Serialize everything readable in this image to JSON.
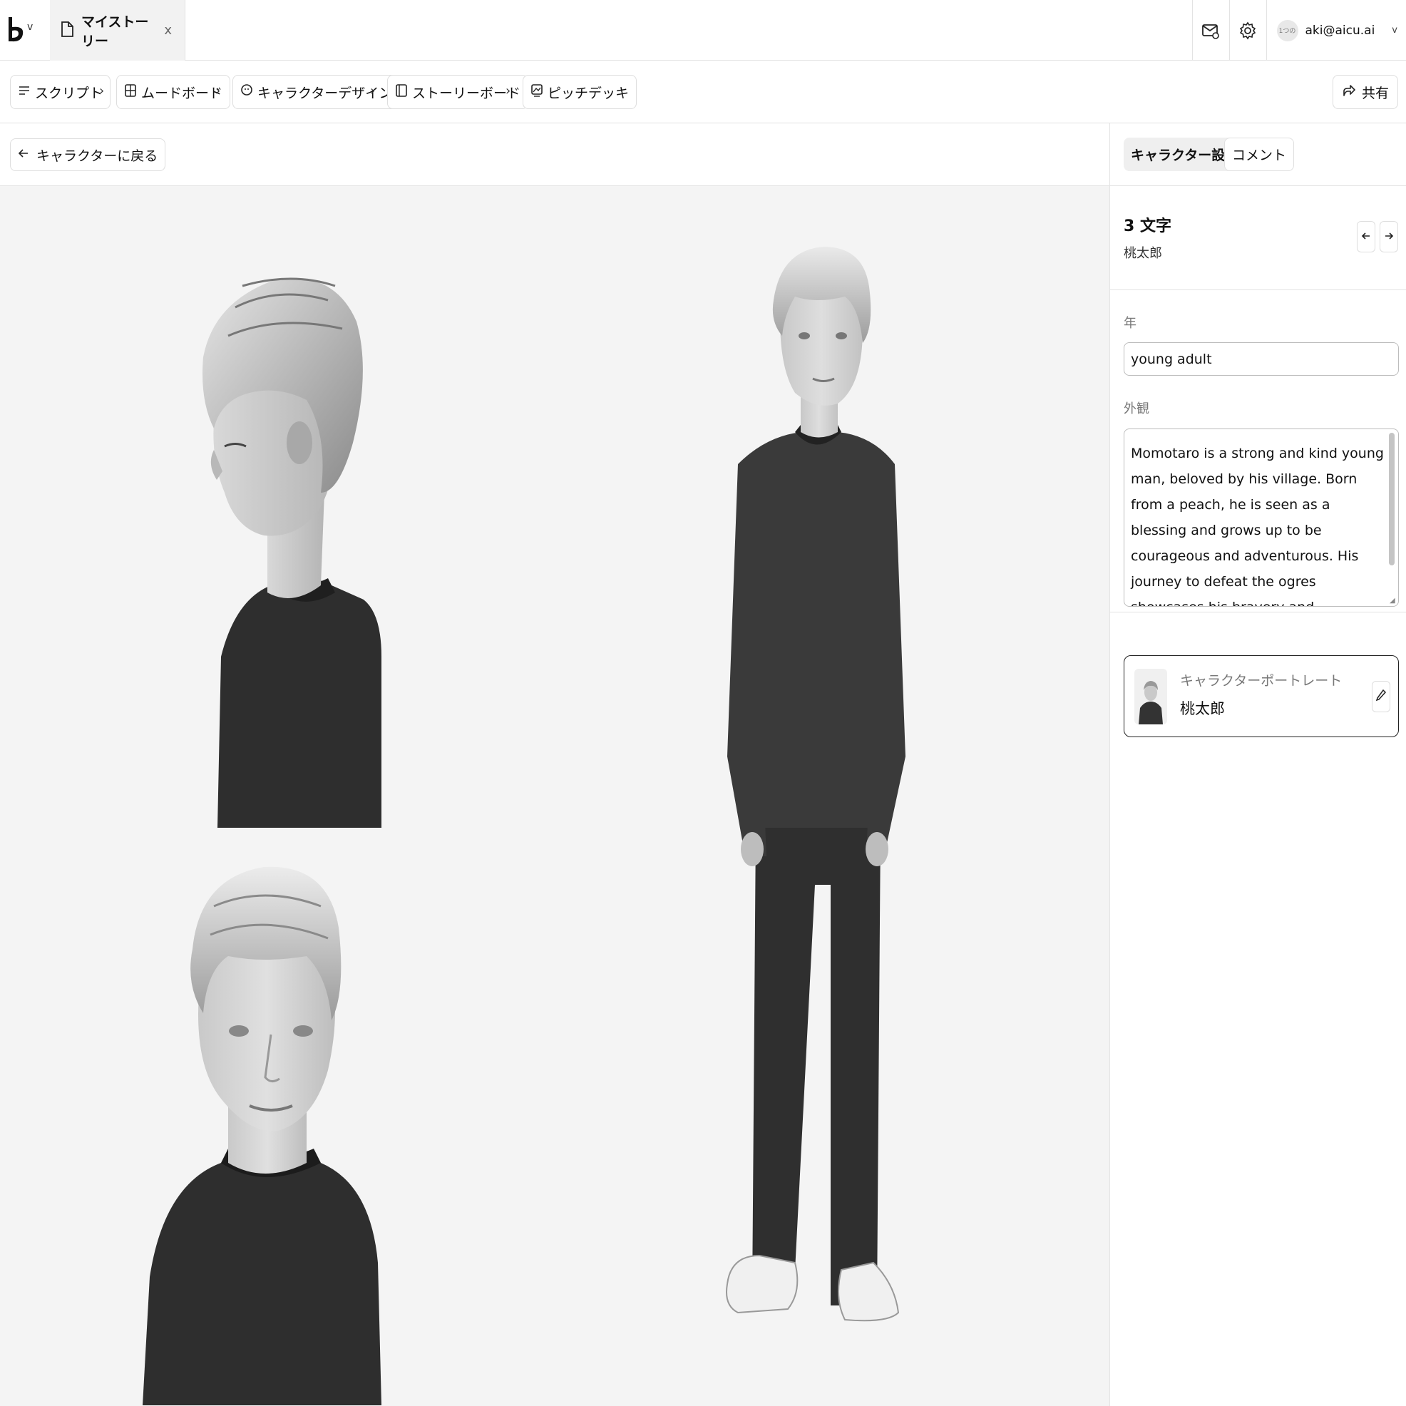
{
  "app": {
    "logo_icon": "brand-logo-icon",
    "file_tab": {
      "icon": "file-icon",
      "label": "マイストーリー",
      "close_label": "x"
    },
    "header_icons": [
      "mail-icon",
      "gear-icon"
    ],
    "user": {
      "avatar_text": "1つの",
      "email": "aki@aicu.ai"
    }
  },
  "pipeline": {
    "steps": [
      {
        "icon": "script-icon",
        "label": "スクリプト"
      },
      {
        "icon": "moodboard-icon",
        "label": "ムードボード"
      },
      {
        "icon": "character-icon",
        "label": "キャラクターデザイン"
      },
      {
        "icon": "storyboard-icon",
        "label": "ストーリーボード"
      },
      {
        "icon": "pitchdeck-icon",
        "label": "ピッチデッキ"
      }
    ],
    "separator": "›",
    "share_label": "共有"
  },
  "subheader": {
    "back_label": "キャラクターに戻る"
  },
  "panel": {
    "tabs": [
      "キャラクター設定",
      "コメント"
    ],
    "count_label": "3 文字",
    "character_name": "桃太郎",
    "age_label": "年",
    "age_value": "young adult",
    "appearance_label": "外観",
    "appearance_value": "Momotaro is a strong and kind young man, beloved by his village. Born from a peach, he is seen as a blessing and grows up to be courageous and adventurous. His journey to defeat the ogres showcases his bravery and leadership, and his return is celebrated by all, marking him as a hero.",
    "portrait_card": {
      "title": "キャラクターポートレート",
      "name": "桃太郎"
    }
  },
  "colors": {
    "canvas_bg": "#f4f4f4",
    "border": "#e3e3e3",
    "text": "#111111"
  }
}
